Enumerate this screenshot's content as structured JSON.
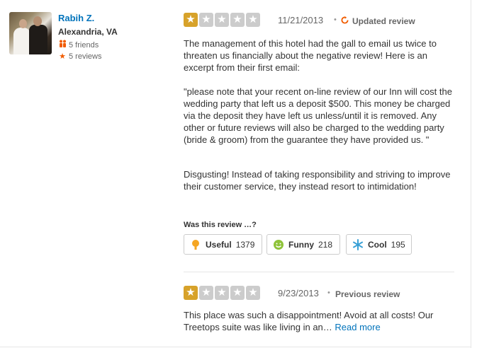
{
  "user": {
    "name": "Rabih Z.",
    "location": "Alexandria, VA",
    "friends": "5 friends",
    "reviews": "5 reviews"
  },
  "review": {
    "rating": 1,
    "date": "11/21/2013",
    "status": "Updated review",
    "paragraphs": [
      "The management of this hotel had the gall to email us twice to threaten us financially about the negative review! Here is an excerpt from their first email:",
      "\"please note that your recent on-line review of our Inn will cost the wedding party that left us a deposit $500.  This money be charged via  the deposit they have left us unless/until it is removed.  Any other or future reviews will also be charged to the wedding party (bride & groom) from the guarantee they have provided us. \"",
      "Disgusting! Instead of taking responsibility and striving to improve their customer service, they instead resort to intimidation!"
    ]
  },
  "votes": {
    "question": "Was this review …?",
    "useful": {
      "label": "Useful",
      "count": "1379",
      "icon": "lightbulb-icon"
    },
    "funny": {
      "label": "Funny",
      "count": "218",
      "icon": "smiley-icon"
    },
    "cool": {
      "label": "Cool",
      "count": "195",
      "icon": "snowflake-icon"
    }
  },
  "previous": {
    "rating": 1,
    "date": "9/23/2013",
    "status": "Previous review",
    "text": "This place was such a disappointment! Avoid at all costs! Our Treetops suite was like living in an…",
    "read_more": "Read more"
  },
  "colors": {
    "star_on": "#d7a22a",
    "star_off": "#cccccc",
    "link": "#0073bb",
    "accent": "#f15c00"
  }
}
